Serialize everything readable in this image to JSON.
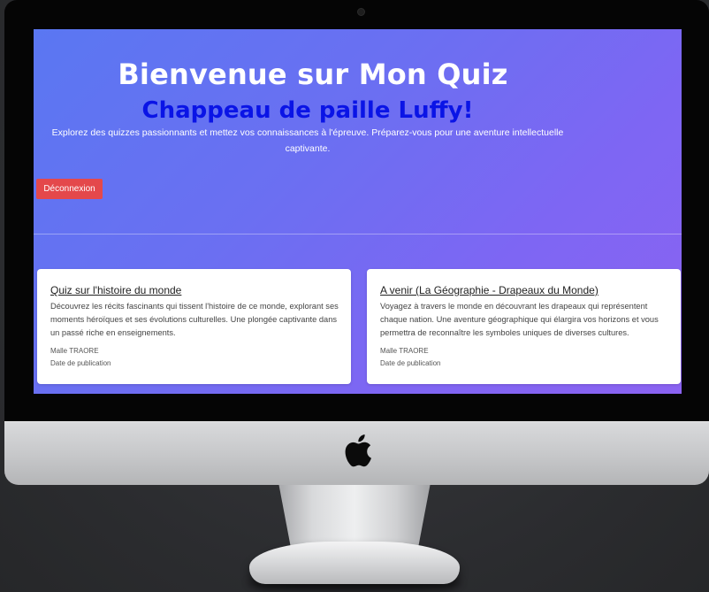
{
  "hero": {
    "title": "Bienvenue sur Mon Quiz",
    "subtitle": "Chappeau de paille Luffy!",
    "description": "Explorez des quizzes passionnants et mettez vos connaissances à l'épreuve. Préparez-vous pour une aventure intellectuelle captivante.",
    "logout_label": "Déconnexion"
  },
  "cards": [
    {
      "title": "Quiz sur l'histoire du monde",
      "description": "Découvrez les récits fascinants qui tissent l'histoire de ce monde, explorant ses moments héroïques et ses évolutions culturelles. Une plongée captivante dans un passé riche en enseignements.",
      "author": "Malle TRAORE",
      "date_label": "Date de publication"
    },
    {
      "title": "A venir (La Géographie - Drapeaux du Monde)",
      "description": "Voyagez à travers le monde en découvrant les drapeaux qui représentent chaque nation. Une aventure géographique qui élargira vos horizons et vous permettra de reconnaître les symboles uniques de diverses cultures.",
      "author": "Malle TRAORE",
      "date_label": "Date de publication"
    }
  ],
  "colors": {
    "gradient_start": "#5a77f2",
    "gradient_end": "#8b63f2",
    "subtitle": "#0a14e6",
    "logout_button": "#e4484b"
  },
  "icons": {
    "monitor_logo": "apple-logo-icon"
  }
}
